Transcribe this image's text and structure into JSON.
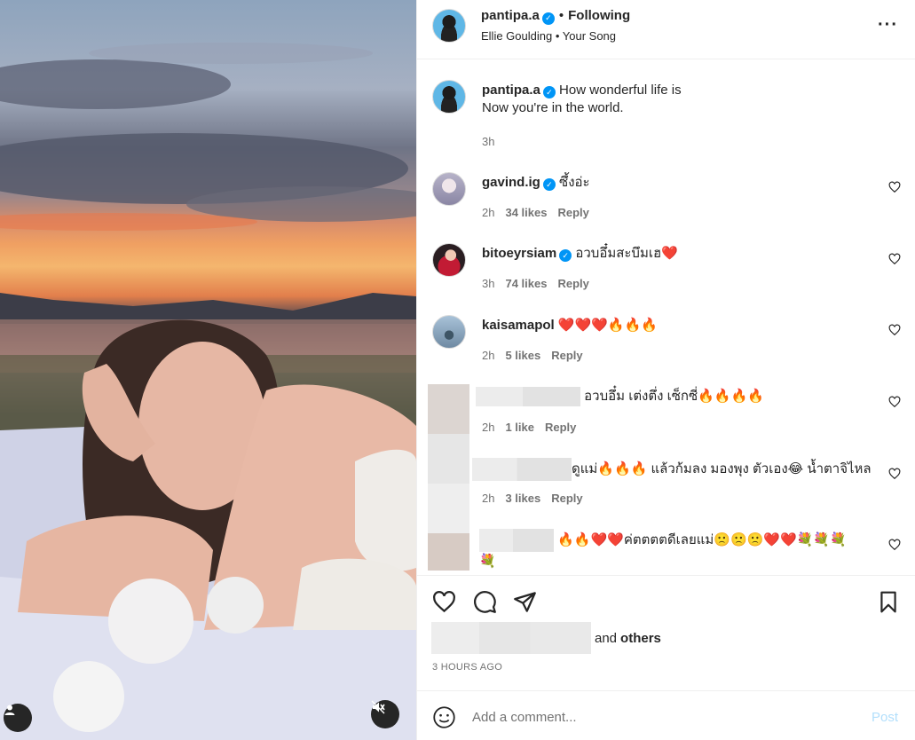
{
  "post": {
    "username": "pantipa.a",
    "following_label": "Following",
    "audio_artist": "Ellie Goulding",
    "audio_song": "Your Song",
    "caption_line1": "How wonderful life is",
    "caption_line2": "Now you're in the world.",
    "caption_time": "3h"
  },
  "comments": [
    {
      "username": "gavind.ig",
      "text": "ซึ้งอ่ะ",
      "time": "2h",
      "likes": "34 likes",
      "reply": "Reply"
    },
    {
      "username": "bitoeyrsiam",
      "text": "อวบอึ๋มสะบึมเฮ❤️",
      "time": "3h",
      "likes": "74 likes",
      "reply": "Reply"
    },
    {
      "username": "kaisamapol",
      "text": "❤️❤️❤️🔥🔥🔥",
      "time": "2h",
      "likes": "5 likes",
      "reply": "Reply"
    },
    {
      "username": "",
      "text": "อวบอึ๋ม เต่งตึ่ง เซ็กซี่🔥🔥🔥🔥",
      "time": "2h",
      "likes": "1 like",
      "reply": "Reply"
    },
    {
      "username": "",
      "text": "ดูแม่🔥🔥🔥 แล้วก้มลง มองพุง ตัวเอง😂 น้ำตาจิไหล",
      "time": "2h",
      "likes": "3 likes",
      "reply": "Reply"
    },
    {
      "username": "",
      "text_line1": "🔥🔥❤️❤️ค่ตตตตดีเลยแม่🙁🙁🙁❤️❤️💐💐💐",
      "text_line2": "💐"
    }
  ],
  "likes": {
    "suffix_prefix": "and",
    "suffix_bold": "others"
  },
  "timestamp": "3 HOURS AGO",
  "add_comment": {
    "placeholder": "Add a comment...",
    "post_label": "Post"
  },
  "colors": {
    "verified": "#0095f6",
    "post_disabled": "#b2dffc",
    "owner_avatar_bg": "#5fb7e6"
  }
}
